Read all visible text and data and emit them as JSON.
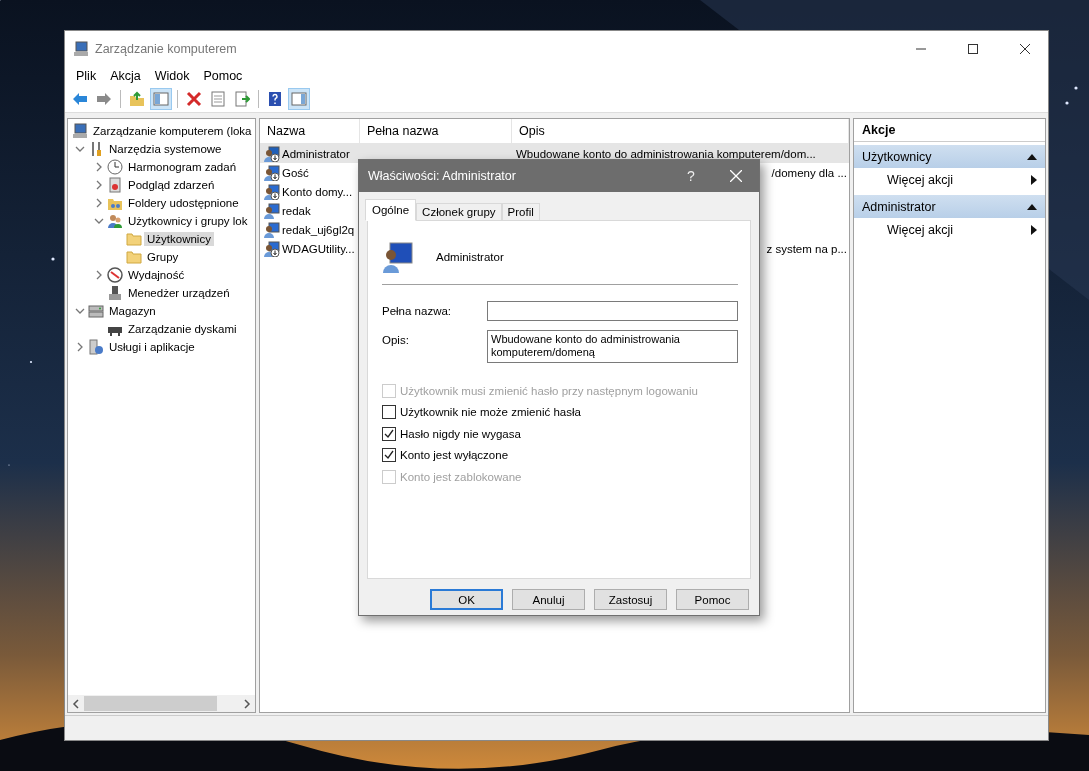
{
  "window": {
    "title": "Zarządzanie komputerem"
  },
  "menu": [
    "Plik",
    "Akcja",
    "Widok",
    "Pomoc"
  ],
  "toolbar": [
    {
      "kind": "back",
      "pressed": false
    },
    {
      "kind": "forward",
      "pressed": false
    },
    {
      "kind": "sep"
    },
    {
      "kind": "up",
      "pressed": false
    },
    {
      "kind": "tree",
      "pressed": true
    },
    {
      "kind": "sep"
    },
    {
      "kind": "delete",
      "pressed": false
    },
    {
      "kind": "properties",
      "pressed": false
    },
    {
      "kind": "export",
      "pressed": false
    },
    {
      "kind": "sep"
    },
    {
      "kind": "help",
      "pressed": false
    },
    {
      "kind": "actions",
      "pressed": true
    }
  ],
  "tree": [
    {
      "label": "Zarządzanie komputerem (loka",
      "kind": "computer",
      "selected": false,
      "children": [
        {
          "label": "Narzędzia systemowe",
          "kind": "tools",
          "expanded": true,
          "selected": false,
          "children": [
            {
              "label": "Harmonogram zadań",
              "kind": "clock",
              "expanded": false,
              "selected": false
            },
            {
              "label": "Podgląd zdarzeń",
              "kind": "events",
              "expanded": false,
              "selected": false
            },
            {
              "label": "Foldery udostępnione",
              "kind": "shared",
              "expanded": false,
              "selected": false
            },
            {
              "label": "Użytkownicy i grupy lok",
              "kind": "users",
              "expanded": true,
              "selected": false,
              "children": [
                {
                  "label": "Użytkownicy",
                  "kind": "folder",
                  "selected": true
                },
                {
                  "label": "Grupy",
                  "kind": "folder",
                  "selected": false
                }
              ]
            },
            {
              "label": "Wydajność",
              "kind": "gauge",
              "expanded": false,
              "selected": false
            },
            {
              "label": "Menedżer urządzeń",
              "kind": "device",
              "selected": false
            }
          ]
        },
        {
          "label": "Magazyn",
          "kind": "storage",
          "expanded": true,
          "selected": false,
          "children": [
            {
              "label": "Zarządzanie dyskami",
              "kind": "disk",
              "selected": false
            }
          ]
        },
        {
          "label": "Usługi i aplikacje",
          "kind": "services",
          "expanded": false,
          "selected": false
        }
      ]
    }
  ],
  "list": {
    "columns": [
      "Nazwa",
      "Pełna nazwa",
      "Opis"
    ],
    "rows": [
      {
        "name": "Administrator",
        "description": "Wbudowane konto do administrowania komputerem/dom...",
        "disabled": true,
        "selected": true
      },
      {
        "name": "Gość",
        "description": "/domeny dla ...",
        "disabled": true,
        "selected": false
      },
      {
        "name": "Konto domy...",
        "disabled": true,
        "selected": false
      },
      {
        "name": "redak",
        "disabled": false,
        "selected": false
      },
      {
        "name": "redak_uj6gl2q",
        "disabled": false,
        "selected": false
      },
      {
        "name": "WDAGUtility...",
        "description": "z system na p...",
        "disabled": true,
        "selected": false
      }
    ]
  },
  "actions": {
    "title": "Akcje",
    "sections": [
      {
        "title": "Użytkownicy",
        "expanded": true,
        "items": [
          "Więcej akcji"
        ]
      },
      {
        "title": "Administrator",
        "expanded": true,
        "items": [
          "Więcej akcji"
        ]
      }
    ]
  },
  "dialog": {
    "title": "Właściwości: Administrator",
    "help": "?",
    "tabs": [
      {
        "label": "Ogólne",
        "selected": true
      },
      {
        "label": "Członek grupy",
        "selected": false
      },
      {
        "label": "Profil",
        "selected": false
      }
    ],
    "user": "Administrator",
    "fields": [
      {
        "label": "Pełna nazwa:",
        "multiline": false
      },
      {
        "label": "Opis:",
        "value": "Wbudowane konto do administrowania komputerem/domeną",
        "multiline": true
      }
    ],
    "checkboxes": [
      {
        "label": "Użytkownik musi zmienić hasło przy następnym logowaniu",
        "checked": false,
        "disabled": true
      },
      {
        "label": "Użytkownik nie może zmienić hasła",
        "checked": false,
        "disabled": false
      },
      {
        "label": "Hasło nigdy nie wygasa",
        "checked": true,
        "disabled": false
      },
      {
        "label": "Konto jest wyłączone",
        "checked": true,
        "disabled": false
      },
      {
        "label": "Konto jest zablokowane",
        "checked": false,
        "disabled": true
      }
    ],
    "buttons": [
      {
        "label": "OK",
        "default": true
      },
      {
        "label": "Anuluj",
        "default": false
      },
      {
        "label": "Zastosuj",
        "default": false
      },
      {
        "label": "Pomoc",
        "default": false
      }
    ]
  }
}
